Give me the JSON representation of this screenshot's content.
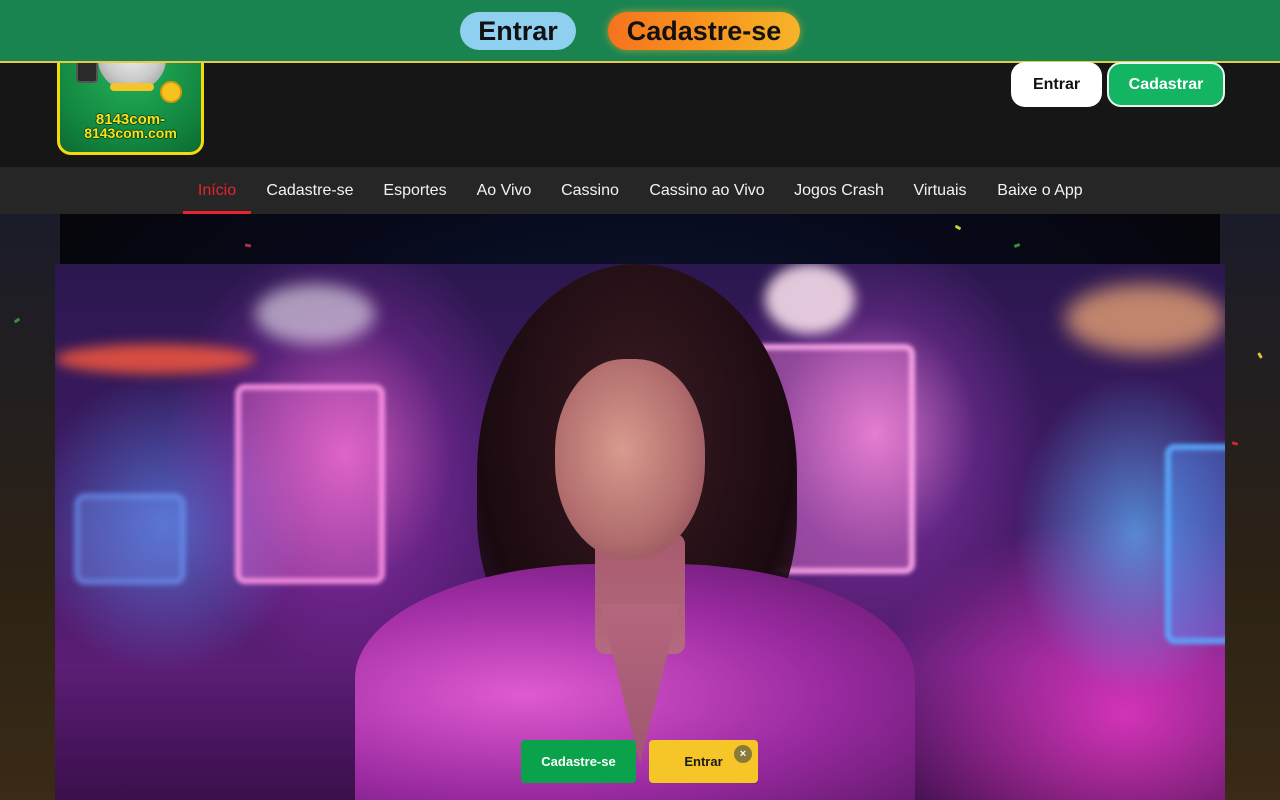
{
  "top_banner": {
    "login_label": "Entrar",
    "register_label": "Cadastre-se"
  },
  "header": {
    "logo_text_line1": "8143com-",
    "logo_text_line2": "8143com.com",
    "login_label": "Entrar",
    "register_label": "Cadastrar"
  },
  "nav": {
    "items": [
      {
        "label": "Início",
        "active": true
      },
      {
        "label": "Cadastre-se"
      },
      {
        "label": "Esportes"
      },
      {
        "label": "Ao Vivo"
      },
      {
        "label": "Cassino"
      },
      {
        "label": "Cassino ao Vivo"
      },
      {
        "label": "Jogos Crash"
      },
      {
        "label": "Virtuais"
      },
      {
        "label": "Baixe o App"
      }
    ]
  },
  "floating_bar": {
    "register_label": "Cadastre-se",
    "login_label": "Entrar",
    "close_glyph": "×"
  },
  "colors": {
    "banner_green": "#1a8451",
    "nav_active": "#e8232d",
    "cta_green": "#0aa24b",
    "cta_yellow": "#f6c527",
    "header_dark": "#161616"
  },
  "icons": [
    "close-icon"
  ]
}
